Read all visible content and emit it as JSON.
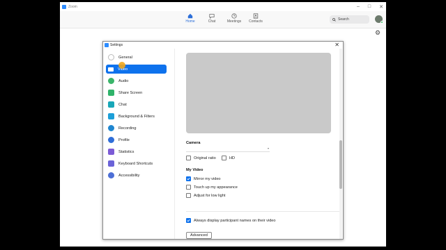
{
  "window": {
    "title": "Zoom",
    "controls": [
      "–",
      "□",
      "✕"
    ]
  },
  "nav": {
    "tabs": [
      {
        "label": "Home",
        "icon": "home-icon",
        "active": true
      },
      {
        "label": "Chat",
        "icon": "chat-icon"
      },
      {
        "label": "Meetings",
        "icon": "clock-icon"
      },
      {
        "label": "Contacts",
        "icon": "contacts-icon"
      }
    ],
    "search_placeholder": "Search"
  },
  "settings": {
    "title": "Settings",
    "close": "✕",
    "sidebar": [
      {
        "label": "General",
        "color": "#d0d0d0"
      },
      {
        "label": "Video",
        "color": "#ffffff",
        "active": true
      },
      {
        "label": "Audio",
        "color": "#3ab56a"
      },
      {
        "label": "Share Screen",
        "color": "#2fb36a"
      },
      {
        "label": "Chat",
        "color": "#18a7b8"
      },
      {
        "label": "Background & Filters",
        "color": "#1c9fd8"
      },
      {
        "label": "Recording",
        "color": "#1f86d0"
      },
      {
        "label": "Profile",
        "color": "#2f6ed8"
      },
      {
        "label": "Statistics",
        "color": "#7c5bd6"
      },
      {
        "label": "Keyboard Shortcuts",
        "color": "#6b63d8"
      },
      {
        "label": "Accessibility",
        "color": "#4d6fd6"
      }
    ],
    "camera_label": "Camera",
    "camera_options": [
      {
        "label": "Original ratio",
        "checked": false
      },
      {
        "label": "HD",
        "checked": false
      }
    ],
    "my_video_label": "My Video",
    "my_video_options": [
      {
        "label": "Mirror my video",
        "checked": true
      },
      {
        "label": "Touch up my appearance",
        "checked": false
      },
      {
        "label": "Adjust for low light",
        "checked": false
      }
    ],
    "names_option": {
      "label": "Always display participant names on their video",
      "checked": true
    },
    "advanced_label": "Advanced"
  },
  "colors": {
    "accent": "#0e72ed",
    "zoom_blue": "#2d8cff"
  }
}
